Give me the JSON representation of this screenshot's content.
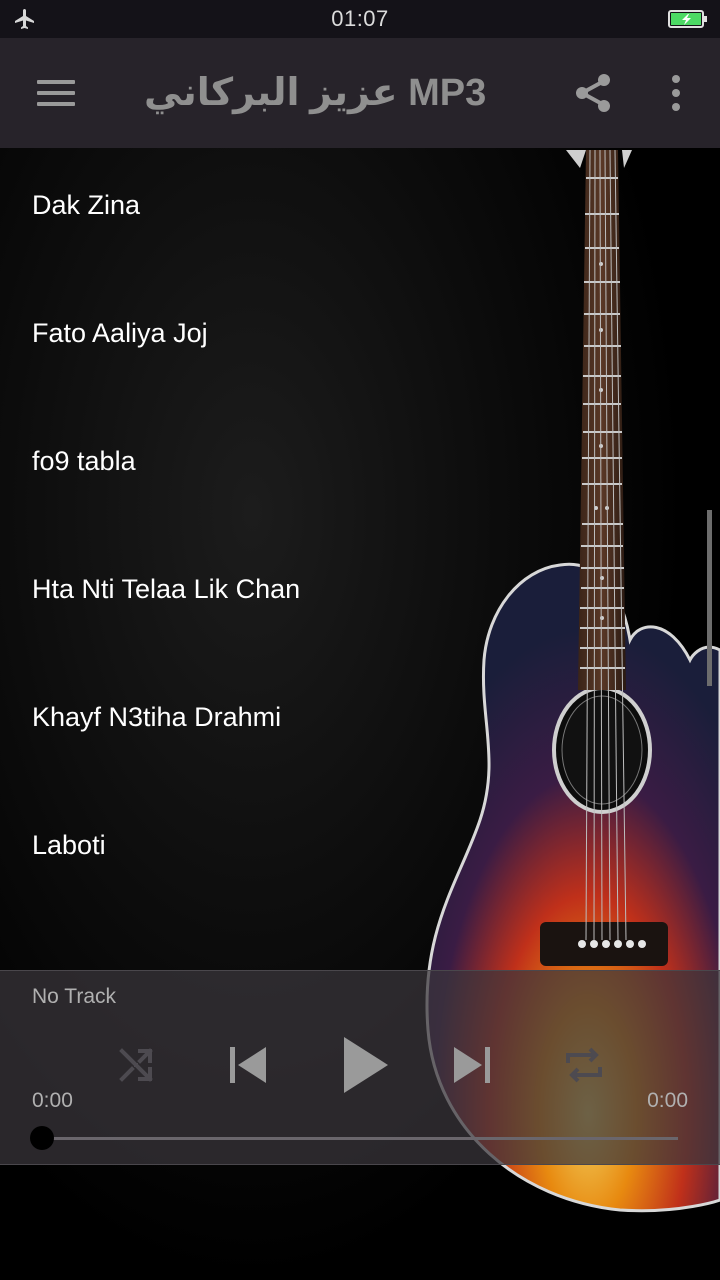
{
  "status_bar": {
    "time": "01:07",
    "icons": [
      "airplane-mode-icon",
      "battery-charging-icon"
    ]
  },
  "app_bar": {
    "title": "عزيز البركاني MP3",
    "icons": [
      "menu-icon",
      "share-icon",
      "more-vert-icon"
    ]
  },
  "tracks": [
    {
      "title": "Dak Zina"
    },
    {
      "title": "Fato Aaliya Joj"
    },
    {
      "title": "fo9 tabla"
    },
    {
      "title": "Hta Nti Telaa Lik Chan"
    },
    {
      "title": "Khayf N3tiha Drahmi"
    },
    {
      "title": "Laboti"
    }
  ],
  "player": {
    "now_playing": "No Track",
    "current_time": "0:00",
    "total_time": "0:00",
    "progress": 0,
    "controls": [
      "shuffle-icon",
      "previous-icon",
      "play-icon",
      "next-icon",
      "repeat-icon"
    ]
  },
  "colors": {
    "app_bar": "#27232a",
    "status_bar": "#141218",
    "title": "#8f8f8f",
    "battery": "#4cd964"
  }
}
